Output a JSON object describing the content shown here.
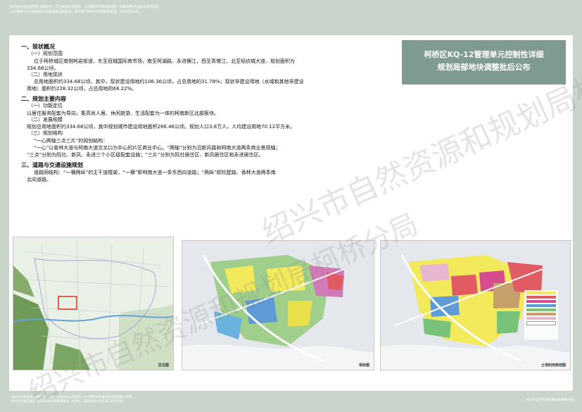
{
  "header": {
    "notes": [
      "依照相关规划控制性详细规划，应当依据法定程序，公示期间不得随意调整，如需调整应当依法进行论证。",
      "公示期间公众可就规划内容提出意见和建议，规划部门将依法处理相关意见，并按程序公告。"
    ]
  },
  "banner": {
    "line1": "柯桥区KQ-12管理单元控制性详细",
    "line2": "规划局部地块调整批后公布"
  },
  "content": {
    "s1_title": "一、现状概况",
    "s1_1_title": "（一）规划范围",
    "s1_1_text1": "位于柯桥城区南侧柯岩街道，东至冠城国际商市场，南至柯湖路、永进横江，西至青墩江，北至轻纺城大道，规划面积为",
    "s1_1_text2": "334.68公顷。",
    "s1_2_title": "（二）用地现状",
    "s1_2_text1": "总用地面积约334.68公顷。其中，现状建设用地约106.36公顷，占总用地的31.78%；现状非建设用地（水域和其他非建设",
    "s1_2_text2": "用地）面积约228.32公顷，占总用地的68.22%。",
    "s2_title": "二、规划主要内容",
    "s2_1_title": "（一）功能定位",
    "s2_1_text": "以居住服务配套为导向，集高尚人居、休闲旅游、生活配套为一体的柯南新区北部板块。",
    "s2_2_title": "（二）发展规模",
    "s2_2_text": "规划总用地面积约334.68公顷，其中规划城市建设用地面积266.46公顷。规划人口3.8万人，人均建设用地70.12平方米。",
    "s2_3_title": "（三）规划结构",
    "s2_3_text1": "“一心两轴三点三片”的规划结构：",
    "s2_3_text2": "“一心”以香林大道与柯南大道交叉口为中心的片区商业中心。“两轴”分别为沿新风路和柯南大道两条商业景观轴；",
    "s2_3_text3": "“三点”分别为阮社、新风、永进三个小区级配套设施；“三片”分别为阮社居住区、新风居住区和永进居住区。",
    "s3_title": "三、道路与交通设施规划",
    "s3_text1": "道路网结构：“一横两纵”的主干道框架，“一横”即柯南大道一条东西向道路；“两纵”即阮墅路、香林大道两条南",
    "s3_text2": "北向道路。"
  },
  "maps": {
    "map1_caption": "区位图",
    "map2_caption": "现状图",
    "map3_caption": "土地利用规划图"
  },
  "footer": {
    "notes": [
      "本次公示的成果为规划全部内容，仅供社会公众查阅。公示期间如有意见请向规划部门反映。",
      "绍兴市自然资源和规划局柯桥分局联系地址：柯桥区，联系电话以规划部门公布为准。"
    ],
    "agency": "绍兴市自然资源和规划局柯桥分局"
  },
  "watermark": {
    "text1": "绍兴市自然资源和规划局柯桥分局",
    "text2": "绍兴市自然资源和规划局柯桥分局"
  }
}
